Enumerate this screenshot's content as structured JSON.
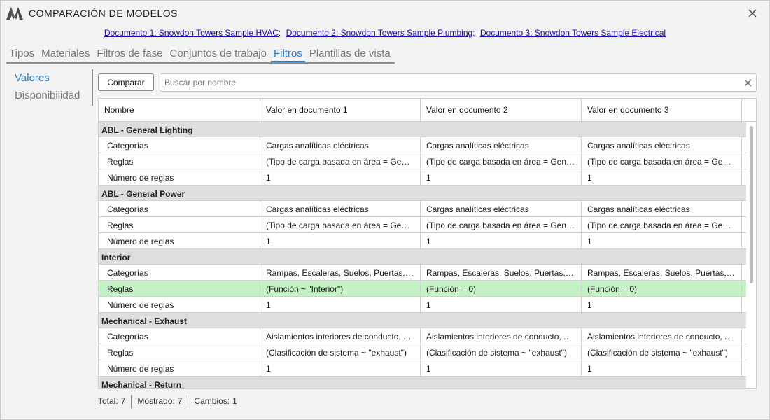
{
  "window": {
    "title": "COMPARACIÓN DE MODELOS",
    "logo_icon": "logo-icon",
    "close_icon": "close-icon"
  },
  "documents": [
    "Documento 1: Snowdon Towers Sample HVAC;",
    "Documento 2: Snowdon Towers Sample Plumbing;",
    "Documento 3: Snowdon Towers Sample Electrical"
  ],
  "tabs": [
    {
      "label": "Tipos"
    },
    {
      "label": "Materiales"
    },
    {
      "label": "Filtros de fase"
    },
    {
      "label": "Conjuntos de trabajo"
    },
    {
      "label": "Filtros",
      "active": true
    },
    {
      "label": "Plantillas de vista"
    }
  ],
  "sidenav": [
    {
      "label": "Valores",
      "active": true
    },
    {
      "label": "Disponibilidad"
    }
  ],
  "toolbar": {
    "compare_label": "Comparar",
    "search_placeholder": "Buscar por nombre",
    "search_value": ""
  },
  "table": {
    "columns": [
      "Nombre",
      "Valor en documento 1",
      "Valor en documento 2",
      "Valor en documento 3"
    ],
    "groups": [
      {
        "name": "ABL - General Lighting",
        "rows": [
          {
            "name": "Categorías",
            "values": [
              "Cargas analíticas eléctricas",
              "Cargas analíticas eléctricas",
              "Cargas analíticas eléctricas"
            ]
          },
          {
            "name": "Reglas",
            "values": [
              "(Tipo de carga basada en área = Gener...",
              "(Tipo de carga basada en área = Gener...",
              "(Tipo de carga basada en área = Gener..."
            ]
          },
          {
            "name": "Número de reglas",
            "values": [
              "1",
              "1",
              "1"
            ]
          }
        ]
      },
      {
        "name": "ABL - General Power",
        "rows": [
          {
            "name": "Categorías",
            "values": [
              "Cargas analíticas eléctricas",
              "Cargas analíticas eléctricas",
              "Cargas analíticas eléctricas"
            ]
          },
          {
            "name": "Reglas",
            "values": [
              "(Tipo de carga basada en área = Gener...",
              "(Tipo de carga basada en área = Gener...",
              "(Tipo de carga basada en área = Gener..."
            ]
          },
          {
            "name": "Número de reglas",
            "values": [
              "1",
              "1",
              "1"
            ]
          }
        ]
      },
      {
        "name": "Interior",
        "rows": [
          {
            "name": "Categorías",
            "values": [
              "Rampas, Escaleras, Suelos, Puertas, Mur...",
              "Rampas, Escaleras, Suelos, Puertas, Mur...",
              "Rampas, Escaleras, Suelos, Puertas, Mur..."
            ]
          },
          {
            "name": "Reglas",
            "values": [
              "(Función ~ \"Interior\")",
              "(Función = 0)",
              "(Función = 0)"
            ],
            "changed": true
          },
          {
            "name": "Número de reglas",
            "values": [
              "1",
              "1",
              "1"
            ]
          }
        ]
      },
      {
        "name": "Mechanical - Exhaust",
        "rows": [
          {
            "name": "Categorías",
            "values": [
              "Aislamientos interiores de conducto, Ai...",
              "Aislamientos interiores de conducto, Ai...",
              "Aislamientos interiores de conducto, Ai..."
            ]
          },
          {
            "name": "Reglas",
            "values": [
              "(Clasificación de sistema ~ \"exhaust\")",
              "(Clasificación de sistema ~ \"exhaust\")",
              "(Clasificación de sistema ~ \"exhaust\")"
            ]
          },
          {
            "name": "Número de reglas",
            "values": [
              "1",
              "1",
              "1"
            ]
          }
        ]
      },
      {
        "name": "Mechanical - Return",
        "rows": [
          {
            "name": "",
            "values": [
              "",
              "",
              ""
            ]
          }
        ]
      }
    ]
  },
  "status": {
    "total_label": "Total:",
    "total": "7",
    "shown_label": "Mostrado:",
    "shown": "7",
    "changes_label": "Cambios:",
    "changes": "1"
  },
  "colors": {
    "accent": "#2a7ac7",
    "changed_row": "#c5f2c5",
    "group_header": "#dedede"
  }
}
